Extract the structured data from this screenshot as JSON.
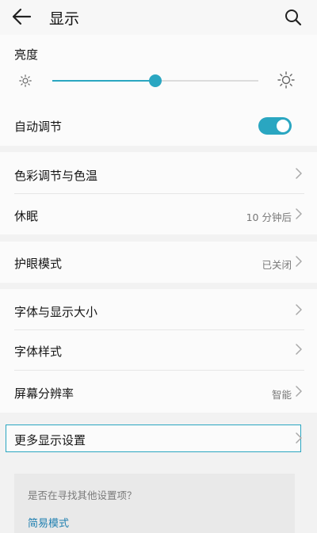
{
  "header": {
    "title": "显示"
  },
  "brightness": {
    "label": "亮度",
    "level_percent": 50
  },
  "auto_adjust": {
    "label": "自动调节",
    "enabled": true
  },
  "settings": {
    "color_temp": {
      "label": "色彩调节与色温"
    },
    "sleep": {
      "label": "休眠",
      "value": "10 分钟后"
    },
    "eye_care": {
      "label": "护眼模式",
      "value": "已关闭"
    },
    "font_display_size": {
      "label": "字体与显示大小"
    },
    "font_style": {
      "label": "字体样式"
    },
    "resolution": {
      "label": "屏幕分辨率",
      "value": "智能"
    },
    "more_display": {
      "label": "更多显示设置"
    }
  },
  "suggestion": {
    "question": "是否在寻找其他设置项？",
    "link": "简易模式"
  },
  "colors": {
    "accent": "#2aa6c1",
    "link": "#1f7fb0"
  }
}
